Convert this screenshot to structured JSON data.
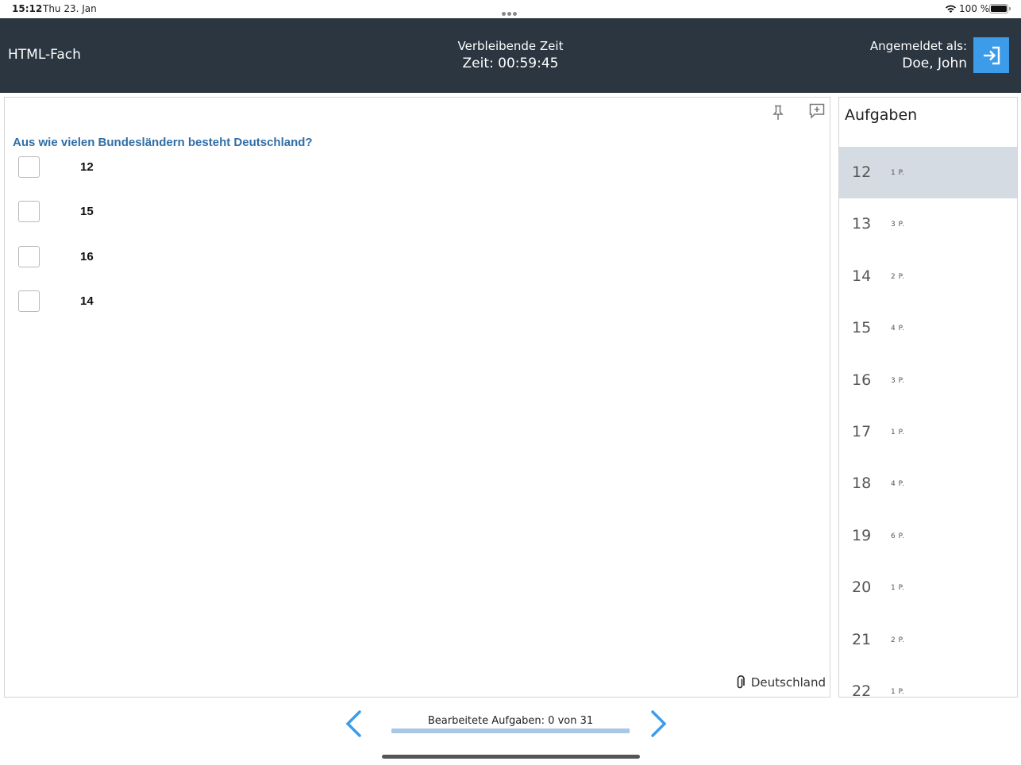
{
  "status_bar": {
    "time": "15:12",
    "date": "Thu 23. Jan",
    "battery": "100 %"
  },
  "header": {
    "subject": "HTML-Fach",
    "timer_label": "Verbleibende Zeit",
    "timer_value": "Zeit: 00:59:45",
    "user_label": "Angemeldet als:",
    "user_name": "Doe, John",
    "logout_icon": "logout-icon"
  },
  "question": {
    "text": "Aus wie vielen Bundesländern besteht Deutschland?",
    "options": [
      "12",
      "15",
      "16",
      "14"
    ],
    "attachment": "Deutschland"
  },
  "tasks": {
    "title": "Aufgaben",
    "items": [
      {
        "num": "12",
        "points": "1 P.",
        "active": true
      },
      {
        "num": "13",
        "points": "3 P."
      },
      {
        "num": "14",
        "points": "2 P."
      },
      {
        "num": "15",
        "points": "4 P."
      },
      {
        "num": "16",
        "points": "3 P."
      },
      {
        "num": "17",
        "points": "1 P."
      },
      {
        "num": "18",
        "points": "4 P."
      },
      {
        "num": "19",
        "points": "6 P."
      },
      {
        "num": "20",
        "points": "1 P."
      },
      {
        "num": "21",
        "points": "2 P."
      },
      {
        "num": "22",
        "points": "1 P."
      }
    ]
  },
  "footer": {
    "progress_label": "Bearbeitete Aufgaben: 0 von 31",
    "progress_fraction": 0
  },
  "colors": {
    "header_bg": "#2b3640",
    "accent": "#3d9cea",
    "question": "#2f6ea7",
    "active_task": "#d4dbe2"
  }
}
